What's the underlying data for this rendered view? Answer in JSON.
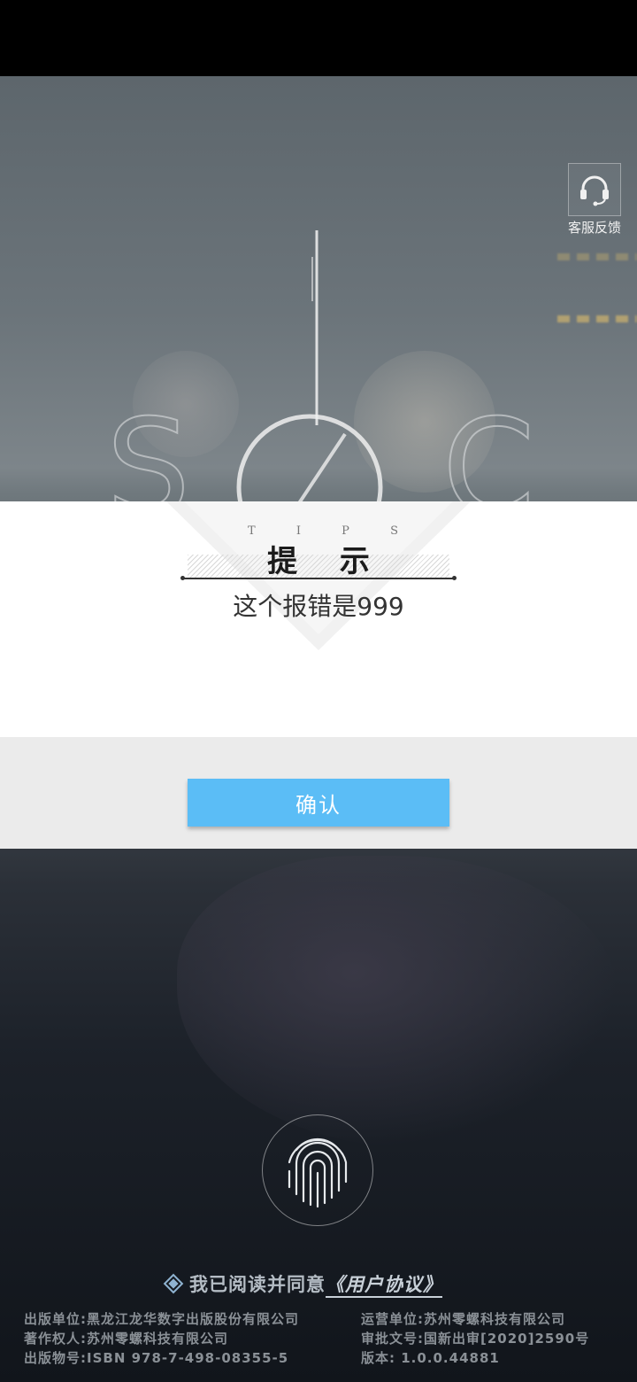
{
  "support": {
    "label": "客服反馈",
    "icon": "headset-icon"
  },
  "logo": {
    "letters": [
      "S",
      "C"
    ]
  },
  "dialog": {
    "tips_letters": [
      "T",
      "I",
      "P",
      "S"
    ],
    "title": "提 示",
    "message": "这个报错是999",
    "confirm_label": "确认"
  },
  "agreement": {
    "text": "我已阅读并同意",
    "link": "《用户协议》",
    "checked": true
  },
  "publisher_left": [
    "出版单位:黑龙江龙华数字出版股份有限公司",
    "著作权人:苏州零螺科技有限公司",
    "出版物号:ISBN 978-7-498-08355-5"
  ],
  "publisher_right": [
    "运营单位:苏州零螺科技有限公司",
    "审批文号:国新出审[2020]2590号",
    "版本: 1.0.0.44881"
  ],
  "colors": {
    "accent": "#5bbdf6",
    "dialog_bg": "#ffffff",
    "footer_bg": "#ebebeb"
  }
}
